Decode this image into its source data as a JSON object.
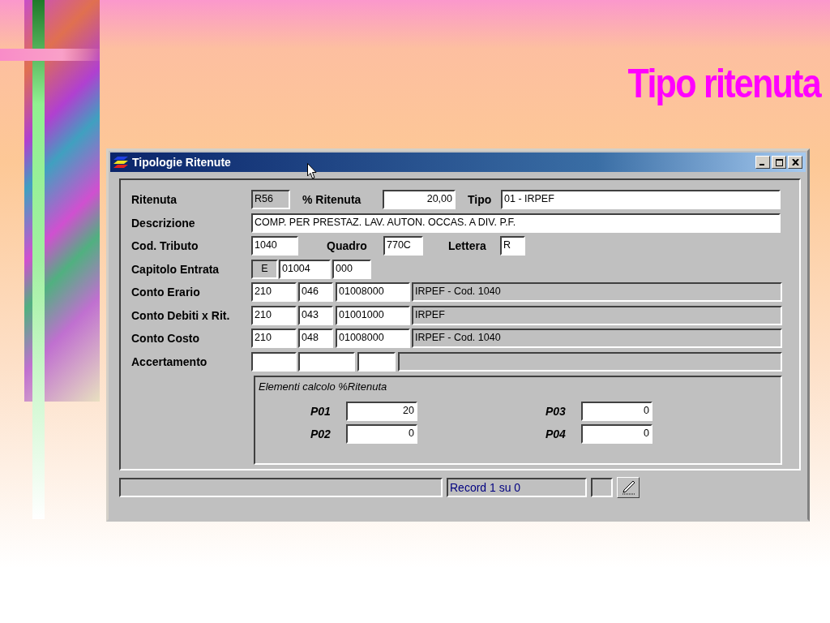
{
  "slide": {
    "title": "Tipo ritenuta"
  },
  "window": {
    "title": "Tipologie Ritenute"
  },
  "form": {
    "rows": [
      {
        "label": "Ritenuta",
        "items": [
          {
            "kind": "field",
            "value": "R56",
            "readonly": true
          },
          {
            "kind": "label",
            "text": "% Ritenuta"
          },
          {
            "kind": "field",
            "value": "20,00",
            "readonly": false
          },
          {
            "kind": "label",
            "text": "Tipo"
          },
          {
            "kind": "field",
            "value": "01 - IRPEF",
            "readonly": false
          }
        ]
      },
      {
        "label": "Descrizione",
        "items": [
          {
            "kind": "field",
            "value": "COMP. PER PRESTAZ. LAV. AUTON. OCCAS. A DIV. P.F.",
            "readonly": false
          }
        ]
      },
      {
        "label": "Cod. Tributo",
        "items": [
          {
            "kind": "field",
            "value": "1040",
            "readonly": false
          },
          {
            "kind": "label",
            "text": "Quadro"
          },
          {
            "kind": "field",
            "value": "770C",
            "readonly": false
          },
          {
            "kind": "label",
            "text": "Lettera"
          },
          {
            "kind": "field",
            "value": "R",
            "readonly": false
          }
        ]
      },
      {
        "label": "Capitolo Entrata",
        "items": [
          {
            "kind": "field",
            "value": "E",
            "readonly": true
          },
          {
            "kind": "field",
            "value": "01004",
            "readonly": false
          },
          {
            "kind": "field",
            "value": "000",
            "readonly": false
          }
        ]
      },
      {
        "label": "Conto Erario",
        "items": [
          {
            "kind": "field",
            "value": "210",
            "readonly": false
          },
          {
            "kind": "field",
            "value": "046",
            "readonly": false
          },
          {
            "kind": "field",
            "value": "01008000",
            "readonly": false
          },
          {
            "kind": "field",
            "value": "IRPEF - Cod. 1040",
            "readonly": true
          }
        ]
      },
      {
        "label": "Conto Debiti x Rit.",
        "items": [
          {
            "kind": "field",
            "value": "210",
            "readonly": false
          },
          {
            "kind": "field",
            "value": "043",
            "readonly": false
          },
          {
            "kind": "field",
            "value": "01001000",
            "readonly": false
          },
          {
            "kind": "field",
            "value": "IRPEF",
            "readonly": true
          }
        ]
      },
      {
        "label": "Conto Costo",
        "items": [
          {
            "kind": "field",
            "value": "210",
            "readonly": false
          },
          {
            "kind": "field",
            "value": "048",
            "readonly": false
          },
          {
            "kind": "field",
            "value": "01008000",
            "readonly": false
          },
          {
            "kind": "field",
            "value": "IRPEF - Cod. 1040",
            "readonly": true
          }
        ]
      },
      {
        "label": "Accertamento",
        "items": [
          {
            "kind": "field",
            "readonly": false
          },
          {
            "kind": "field",
            "readonly": false
          },
          {
            "kind": "field",
            "readonly": false
          },
          {
            "kind": "field",
            "readonly": true
          }
        ]
      }
    ]
  },
  "group": {
    "legend": "Elementi calcolo %Ritenuta",
    "params": [
      {
        "label": "P01",
        "value": "20"
      },
      {
        "label": "P03",
        "value": "0"
      },
      {
        "label": "P02",
        "value": "0"
      },
      {
        "label": "P04",
        "value": "0"
      }
    ]
  },
  "status_bar": {
    "record": "Record 1 su 0"
  }
}
